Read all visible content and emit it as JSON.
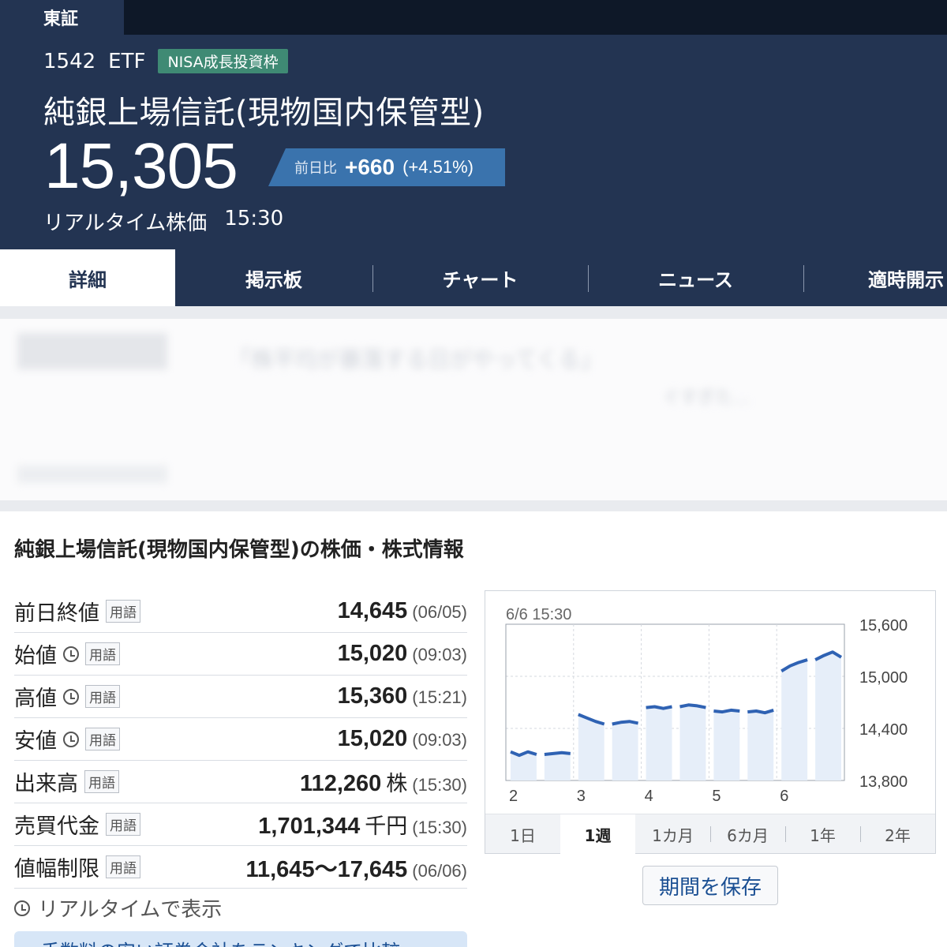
{
  "header": {
    "exchange": "東証",
    "code": "1542",
    "type": "ETF",
    "nisa_badge": "NISA成長投資枠",
    "name": "純銀上場信託(現物国内保管型)",
    "price": "15,305",
    "change_label": "前日比",
    "change_value": "+660",
    "change_pct": "(+4.51%)",
    "realtime_label": "リアルタイム株価",
    "time": "15:30"
  },
  "tabs": [
    {
      "label": "詳細",
      "active": true
    },
    {
      "label": "掲示板"
    },
    {
      "label": "チャート"
    },
    {
      "label": "ニュース"
    },
    {
      "label": "適時開示"
    }
  ],
  "ad": {
    "line1": "「株平均が暴落する日がやってくる」",
    "line2": "ぐすぎた…"
  },
  "section_title": "純銀上場信託(現物国内保管型)の株価・株式情報",
  "term_label": "用語",
  "rows": [
    {
      "label": "前日終値",
      "clock": false,
      "value": "14,645",
      "unit": "",
      "ts": "(06/05)"
    },
    {
      "label": "始値",
      "clock": true,
      "value": "15,020",
      "unit": "",
      "ts": "(09:03)"
    },
    {
      "label": "高値",
      "clock": true,
      "value": "15,360",
      "unit": "",
      "ts": "(15:21)"
    },
    {
      "label": "安値",
      "clock": true,
      "value": "15,020",
      "unit": "",
      "ts": "(09:03)"
    },
    {
      "label": "出来高",
      "clock": false,
      "value": "112,260",
      "unit": "株",
      "ts": "(15:30)"
    },
    {
      "label": "売買代金",
      "clock": false,
      "value": "1,701,344",
      "unit": "千円",
      "ts": "(15:30)"
    },
    {
      "label": "値幅制限",
      "clock": false,
      "value": "11,645〜17,645",
      "unit": "",
      "ts": "(06/06)"
    }
  ],
  "realtime_note": "リアルタイムで表示",
  "compare_button": "手数料の安い証券会社をランキングで比較",
  "chart_data": {
    "type": "area",
    "timestamp": "6/6 15:30",
    "x_labels": [
      "2",
      "3",
      "4",
      "5",
      "6"
    ],
    "y_ticks": [
      "15,600",
      "15,000",
      "14,400",
      "13,800"
    ],
    "ylim": [
      13800,
      15600
    ],
    "series": [
      {
        "values": [
          14130,
          14090,
          14130,
          14100
        ]
      },
      {
        "values": [
          14100,
          14110,
          14120,
          14110
        ]
      },
      {
        "values": [
          14560,
          14520,
          14480,
          14450
        ]
      },
      {
        "values": [
          14450,
          14470,
          14480,
          14460
        ]
      },
      {
        "values": [
          14640,
          14650,
          14630,
          14650
        ]
      },
      {
        "values": [
          14650,
          14670,
          14660,
          14640
        ]
      },
      {
        "values": [
          14600,
          14590,
          14610,
          14600
        ]
      },
      {
        "values": [
          14590,
          14600,
          14580,
          14610
        ]
      },
      {
        "values": [
          15060,
          15120,
          15160,
          15190
        ]
      },
      {
        "values": [
          15190,
          15240,
          15280,
          15220
        ]
      }
    ],
    "color": "#2f62b3",
    "fill": "#e6eef9"
  },
  "periods": [
    {
      "label": "1日"
    },
    {
      "label": "1週",
      "active": true
    },
    {
      "label": "1カ月"
    },
    {
      "label": "6カ月"
    },
    {
      "label": "1年"
    },
    {
      "label": "2年"
    }
  ],
  "save_button": "期間を保存"
}
